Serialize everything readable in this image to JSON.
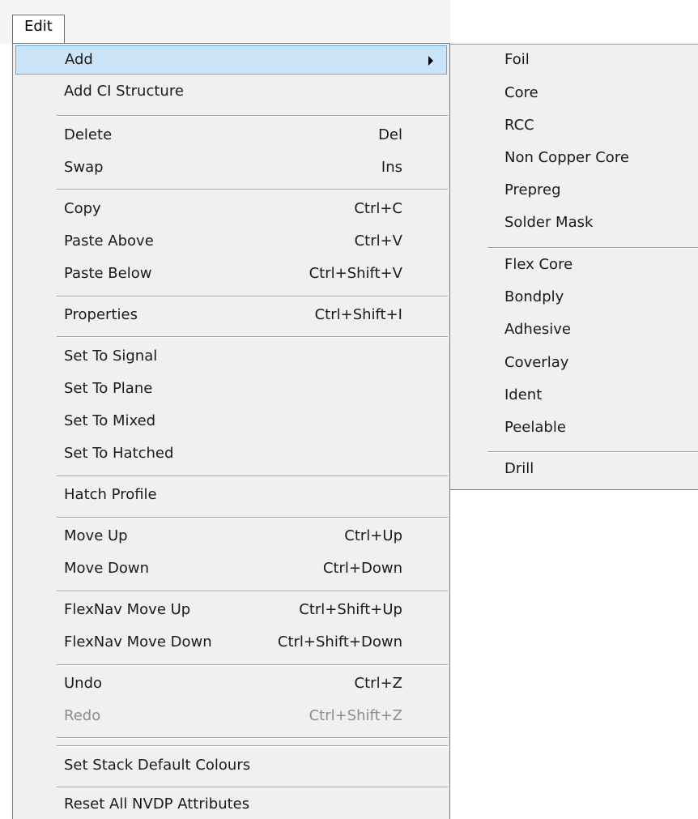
{
  "menubar": {
    "edit_label": "Edit"
  },
  "menu": {
    "items": [
      {
        "label": "Add",
        "shortcut": "",
        "has_submenu": true,
        "highlighted": true
      },
      {
        "label": "Add CI Structure",
        "shortcut": ""
      },
      {
        "label": "Delete",
        "shortcut": "Del"
      },
      {
        "label": "Swap",
        "shortcut": "Ins"
      },
      {
        "label": "Copy",
        "shortcut": "Ctrl+C"
      },
      {
        "label": "Paste Above",
        "shortcut": "Ctrl+V"
      },
      {
        "label": "Paste Below",
        "shortcut": "Ctrl+Shift+V"
      },
      {
        "label": "Properties",
        "shortcut": "Ctrl+Shift+I"
      },
      {
        "label": "Set To Signal",
        "shortcut": ""
      },
      {
        "label": "Set To Plane",
        "shortcut": ""
      },
      {
        "label": "Set To Mixed",
        "shortcut": ""
      },
      {
        "label": "Set To Hatched",
        "shortcut": ""
      },
      {
        "label": "Hatch Profile",
        "shortcut": ""
      },
      {
        "label": "Move Up",
        "shortcut": "Ctrl+Up"
      },
      {
        "label": "Move Down",
        "shortcut": "Ctrl+Down"
      },
      {
        "label": "FlexNav Move Up",
        "shortcut": "Ctrl+Shift+Up"
      },
      {
        "label": "FlexNav Move Down",
        "shortcut": "Ctrl+Shift+Down"
      },
      {
        "label": "Undo",
        "shortcut": "Ctrl+Z"
      },
      {
        "label": "Redo",
        "shortcut": "Ctrl+Shift+Z",
        "disabled": true
      },
      {
        "label": "Set Stack Default Colours",
        "shortcut": ""
      },
      {
        "label": "Reset All NVDP Attributes",
        "shortcut": ""
      }
    ]
  },
  "submenu": {
    "items": [
      {
        "label": "Foil"
      },
      {
        "label": "Core"
      },
      {
        "label": "RCC"
      },
      {
        "label": "Non Copper Core"
      },
      {
        "label": "Prepreg"
      },
      {
        "label": "Solder Mask"
      },
      {
        "label": "Flex Core"
      },
      {
        "label": "Bondply"
      },
      {
        "label": "Adhesive"
      },
      {
        "label": "Coverlay"
      },
      {
        "label": "Ident"
      },
      {
        "label": "Peelable"
      },
      {
        "label": "Drill"
      }
    ]
  },
  "colors": {
    "menu_background": "#f0f0f0",
    "highlight_fill": "#cce4f7",
    "highlight_border": "#69a6d9",
    "disabled_text": "#8c8c8c"
  }
}
